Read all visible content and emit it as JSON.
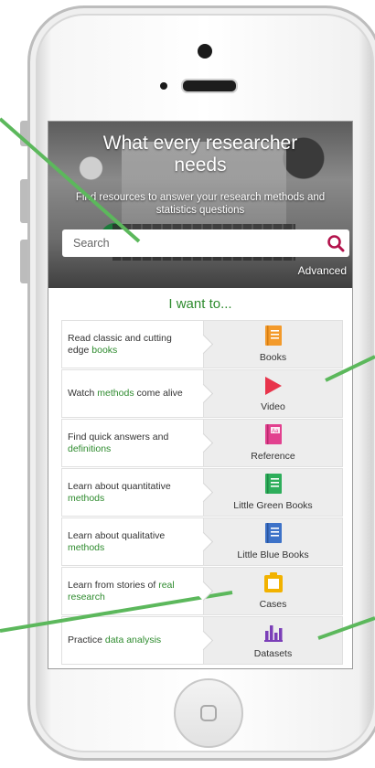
{
  "hero": {
    "title": "What every researcher needs",
    "subtitle": "Find resources to answer your research methods and statistics questions"
  },
  "search": {
    "placeholder": "Search",
    "advanced_label": "Advanced"
  },
  "iwant_heading": "I want to...",
  "rows": [
    {
      "pre": "Read classic and cutting edge ",
      "hl": "books",
      "post": "",
      "label": "Books",
      "icon": "book-icon",
      "color": "#f39a2b"
    },
    {
      "pre": "Watch ",
      "hl": "methods",
      "post": " come alive",
      "label": "Video",
      "icon": "play-icon",
      "color": "#e8344b"
    },
    {
      "pre": "Find quick answers and ",
      "hl": "definitions",
      "post": "",
      "label": "Reference",
      "icon": "reference-icon",
      "color": "#e2418f"
    },
    {
      "pre": "Learn about quantitative ",
      "hl": "methods",
      "post": "",
      "label": "Little Green Books",
      "icon": "green-book-icon",
      "color": "#2eae5b"
    },
    {
      "pre": "Learn about qualitative ",
      "hl": "methods",
      "post": "",
      "label": "Little Blue Books",
      "icon": "blue-book-icon",
      "color": "#3d72c8"
    },
    {
      "pre": "Learn from stories of ",
      "hl": "real research",
      "post": "",
      "label": "Cases",
      "icon": "case-icon",
      "color": "#f2b200"
    },
    {
      "pre": "Practice ",
      "hl": "data analysis",
      "post": "",
      "label": "Datasets",
      "icon": "bar-chart-icon",
      "color": "#7b3fb8"
    }
  ],
  "colors": {
    "accent_green": "#2e8b2e",
    "search_icon": "#b3124b",
    "annotation_line": "#5cb85c"
  }
}
